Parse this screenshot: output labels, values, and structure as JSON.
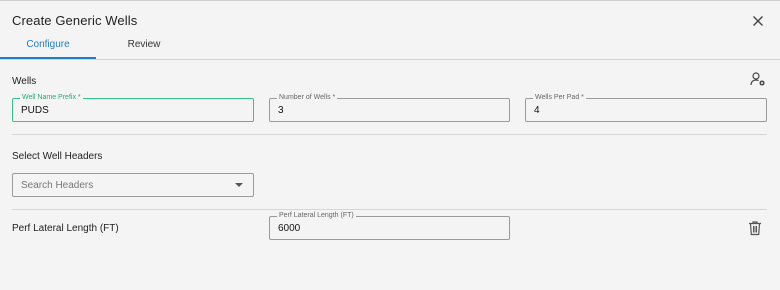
{
  "dialog": {
    "title": "Create Generic Wells"
  },
  "tabs": [
    {
      "label": "Configure",
      "active": true
    },
    {
      "label": "Review",
      "active": false
    }
  ],
  "wells": {
    "section_label": "Wells",
    "well_name_prefix": {
      "label": "Well Name Prefix *",
      "value": "PUDS"
    },
    "number_of_wells": {
      "label": "Number of Wells *",
      "value": "3"
    },
    "wells_per_pad": {
      "label": "Wells Per Pad *",
      "value": "4"
    }
  },
  "headers": {
    "section_label": "Select Well Headers",
    "search_placeholder": "Search Headers"
  },
  "perf": {
    "section_label": "Perf Lateral Length (FT)",
    "field_label": "Perf Lateral Length (FT)",
    "value": "6000"
  },
  "icons": {
    "close": "close-icon",
    "user_settings": "user-settings-icon",
    "delete": "trash-icon",
    "dropdown": "chevron-down-icon"
  },
  "colors": {
    "accent": "#1f7ec8",
    "focus_border": "#34c48a",
    "background": "#f4f4f4"
  }
}
